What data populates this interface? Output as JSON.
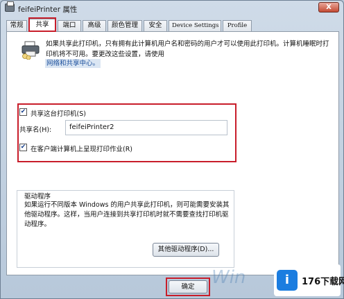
{
  "window": {
    "title": "feifeiPrinter 属性",
    "close_label": "X"
  },
  "tabs": [
    {
      "label": "常规"
    },
    {
      "label": "共享"
    },
    {
      "label": "端口"
    },
    {
      "label": "高级"
    },
    {
      "label": "颜色管理"
    },
    {
      "label": "安全"
    },
    {
      "label": "Device Settings"
    },
    {
      "label": "Profile"
    }
  ],
  "sharing": {
    "info_text": "如果共享此打印机，只有拥有此计算机用户名和密码的用户才可以使用此打印机。计算机睡眠时打印机将不可用。要更改这些设置，请使用",
    "info_link": "网络和共享中心。",
    "share_checkbox": {
      "label": "共享这台打印机(S)",
      "checked": true
    },
    "share_name_label": "共享名(H):",
    "share_name_value": "feifeiPrinter2",
    "render_checkbox": {
      "label": "在客户端计算机上呈现打印作业(R)",
      "checked": true
    }
  },
  "drivers": {
    "title": "驱动程序",
    "text": "如果运行不同版本 Windows 的用户共享此打印机，则可能需要安装其他驱动程序。这样，当用户连接到共享打印机时就不需要查找打印机驱动程序。",
    "other_drivers_button": "其他驱动程序(D)..."
  },
  "buttons": {
    "ok": "确定"
  },
  "watermark": {
    "site_icon": "i",
    "site_text": "176下载网"
  }
}
